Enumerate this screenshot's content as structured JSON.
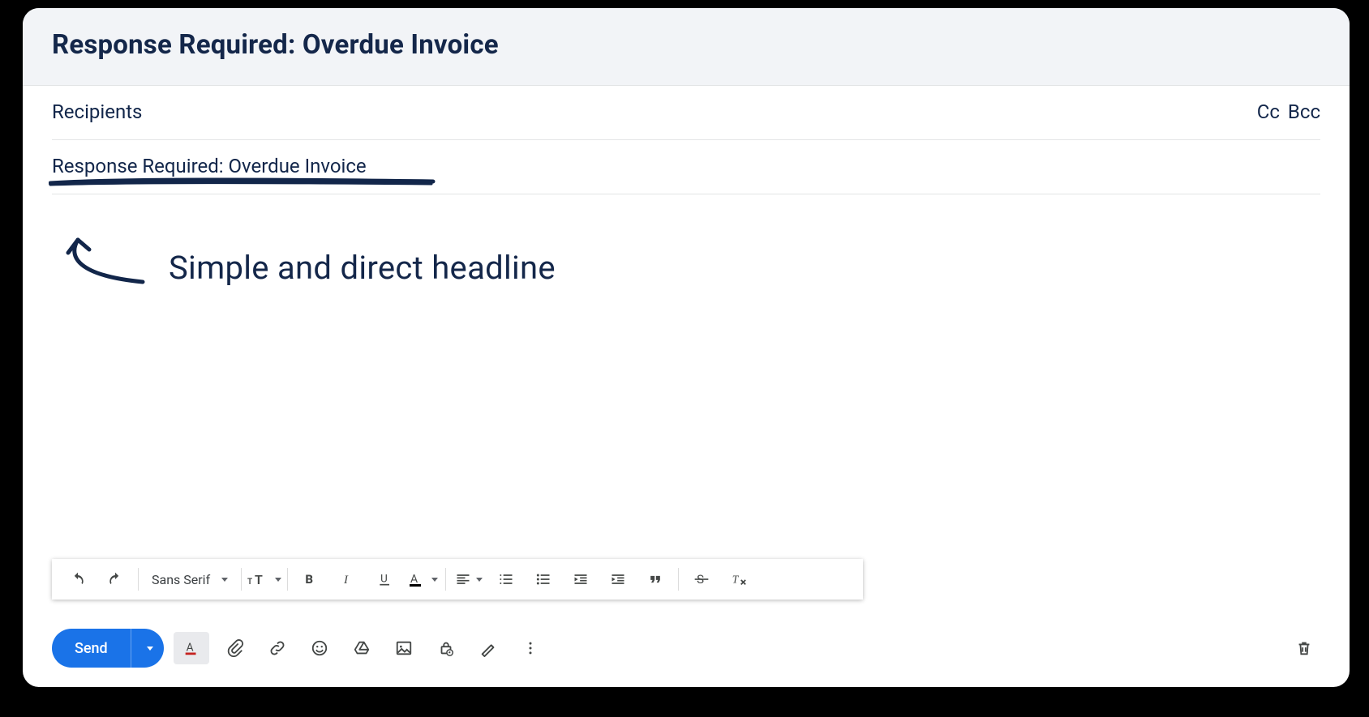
{
  "header": {
    "title": "Response Required: Overdue Invoice"
  },
  "recipients": {
    "label": "Recipients",
    "cc": "Cc",
    "bcc": "Bcc"
  },
  "subject": {
    "value": "Response Required: Overdue Invoice"
  },
  "annotation": {
    "text": "Simple and direct headline"
  },
  "format_toolbar": {
    "font": "Sans Serif",
    "icons": {
      "undo": "undo-icon",
      "redo": "redo-icon",
      "text_size": "text-size-icon",
      "bold": "bold-icon",
      "italic": "italic-icon",
      "underline": "underline-icon",
      "text_color": "text-color-icon",
      "align": "align-icon",
      "ordered_list": "ordered-list-icon",
      "bullet_list": "bullet-list-icon",
      "indent_less": "indent-less-icon",
      "indent_more": "indent-more-icon",
      "quote": "quote-icon",
      "strike": "strikethrough-icon",
      "clear": "clear-format-icon"
    }
  },
  "bottom_bar": {
    "send": "Send",
    "icons": {
      "formatting": "formatting-options-icon",
      "attach": "attach-icon",
      "link": "link-icon",
      "emoji": "emoji-icon",
      "drive": "drive-icon",
      "image": "image-icon",
      "confidential": "confidential-icon",
      "signature": "signature-icon",
      "more": "more-icon",
      "trash": "trash-icon"
    }
  }
}
